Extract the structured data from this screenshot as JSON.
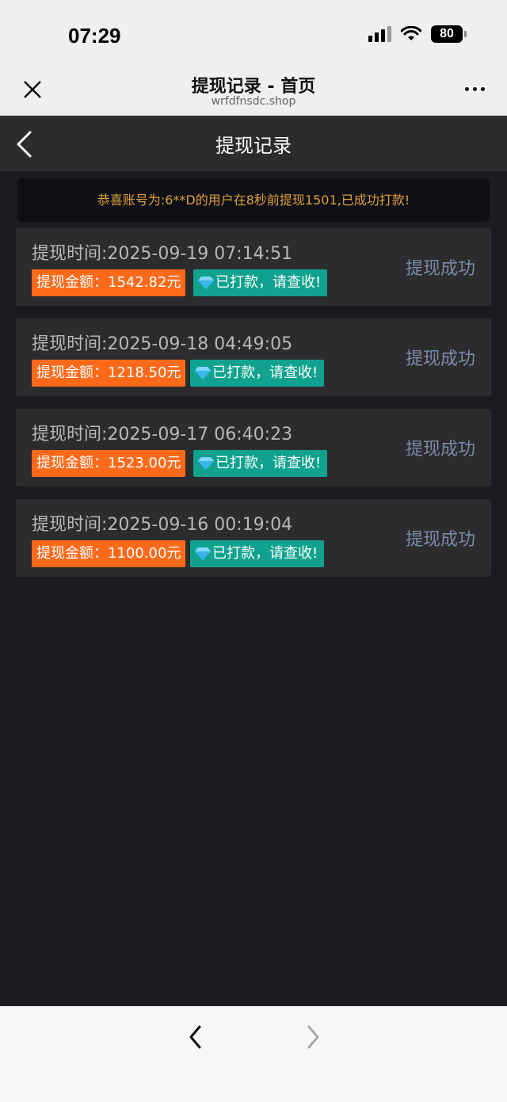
{
  "status_bar": {
    "time": "07:29",
    "battery": "80"
  },
  "browser": {
    "title": "提现记录 - 首页",
    "url": "wrfdfnsdc.shop"
  },
  "page": {
    "title": "提现记录",
    "notice": "恭喜账号为:6**D的用户在8秒前提现1501,已成功打款!"
  },
  "records": [
    {
      "time": "提现时间:2025-09-19 07:14:51",
      "amount": "提现金额：1542.82元",
      "paid": "已打款，请查收!",
      "status": "提现成功"
    },
    {
      "time": "提现时间:2025-09-18 04:49:05",
      "amount": "提现金额：1218.50元",
      "paid": "已打款，请查收!",
      "status": "提现成功"
    },
    {
      "time": "提现时间:2025-09-17 06:40:23",
      "amount": "提现金额：1523.00元",
      "paid": "已打款，请查收!",
      "status": "提现成功"
    },
    {
      "time": "提现时间:2025-09-16 00:19:04",
      "amount": "提现金额：1100.00元",
      "paid": "已打款，请查收!",
      "status": "提现成功"
    }
  ],
  "colors": {
    "amount_badge": "#ff6a1a",
    "paid_badge": "#10a28e",
    "status_text": "#7c8aa8",
    "notice_text": "#e0a03a"
  },
  "icons": {
    "close": "close-icon",
    "more": "more-dots-icon",
    "back": "chevron-left-icon",
    "gem": "diamond-icon",
    "browser_back": "chevron-left-icon",
    "browser_forward": "chevron-right-icon"
  }
}
